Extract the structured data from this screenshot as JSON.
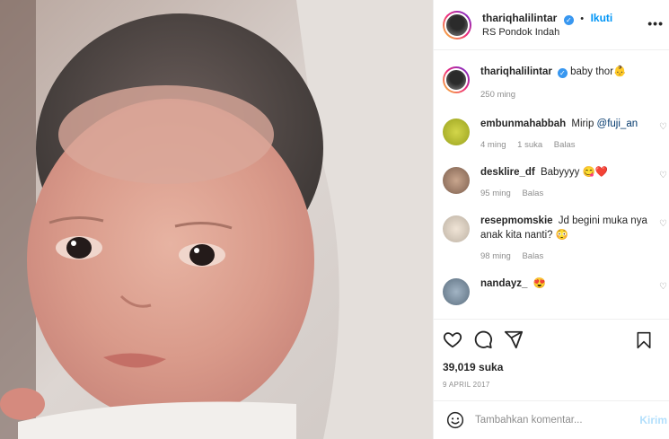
{
  "post": {
    "author": "thariqhalilintar",
    "follow_label": "Ikuti",
    "location": "RS Pondok Indah",
    "more_label": "•••"
  },
  "caption": {
    "username": "thariqhalilintar",
    "text": "baby thor👶",
    "time": "250 ming"
  },
  "comments": [
    {
      "username": "embunmahabbah",
      "text": "Mirip ",
      "mention": "@fuji_an",
      "time": "4 ming",
      "likes": "1 suka",
      "reply": "Balas"
    },
    {
      "username": "desklire_df",
      "text": "Babyyyy 😋❤️",
      "time": "95 ming",
      "reply": "Balas"
    },
    {
      "username": "resepmomskie",
      "text": "Jd begini muka nya anak kita nanti? 😳",
      "time": "98 ming",
      "reply": "Balas"
    },
    {
      "username": "nandayz_",
      "text": "😍"
    }
  ],
  "stats": {
    "likes": "39,019 suka",
    "date": "9 APRIL 2017"
  },
  "add_comment": {
    "placeholder": "Tambahkan komentar...",
    "post_label": "Kirim"
  },
  "icons": [
    "heart-icon",
    "comment-icon",
    "share-icon",
    "bookmark-icon",
    "emoji-icon",
    "more-icon",
    "verified-icon"
  ]
}
